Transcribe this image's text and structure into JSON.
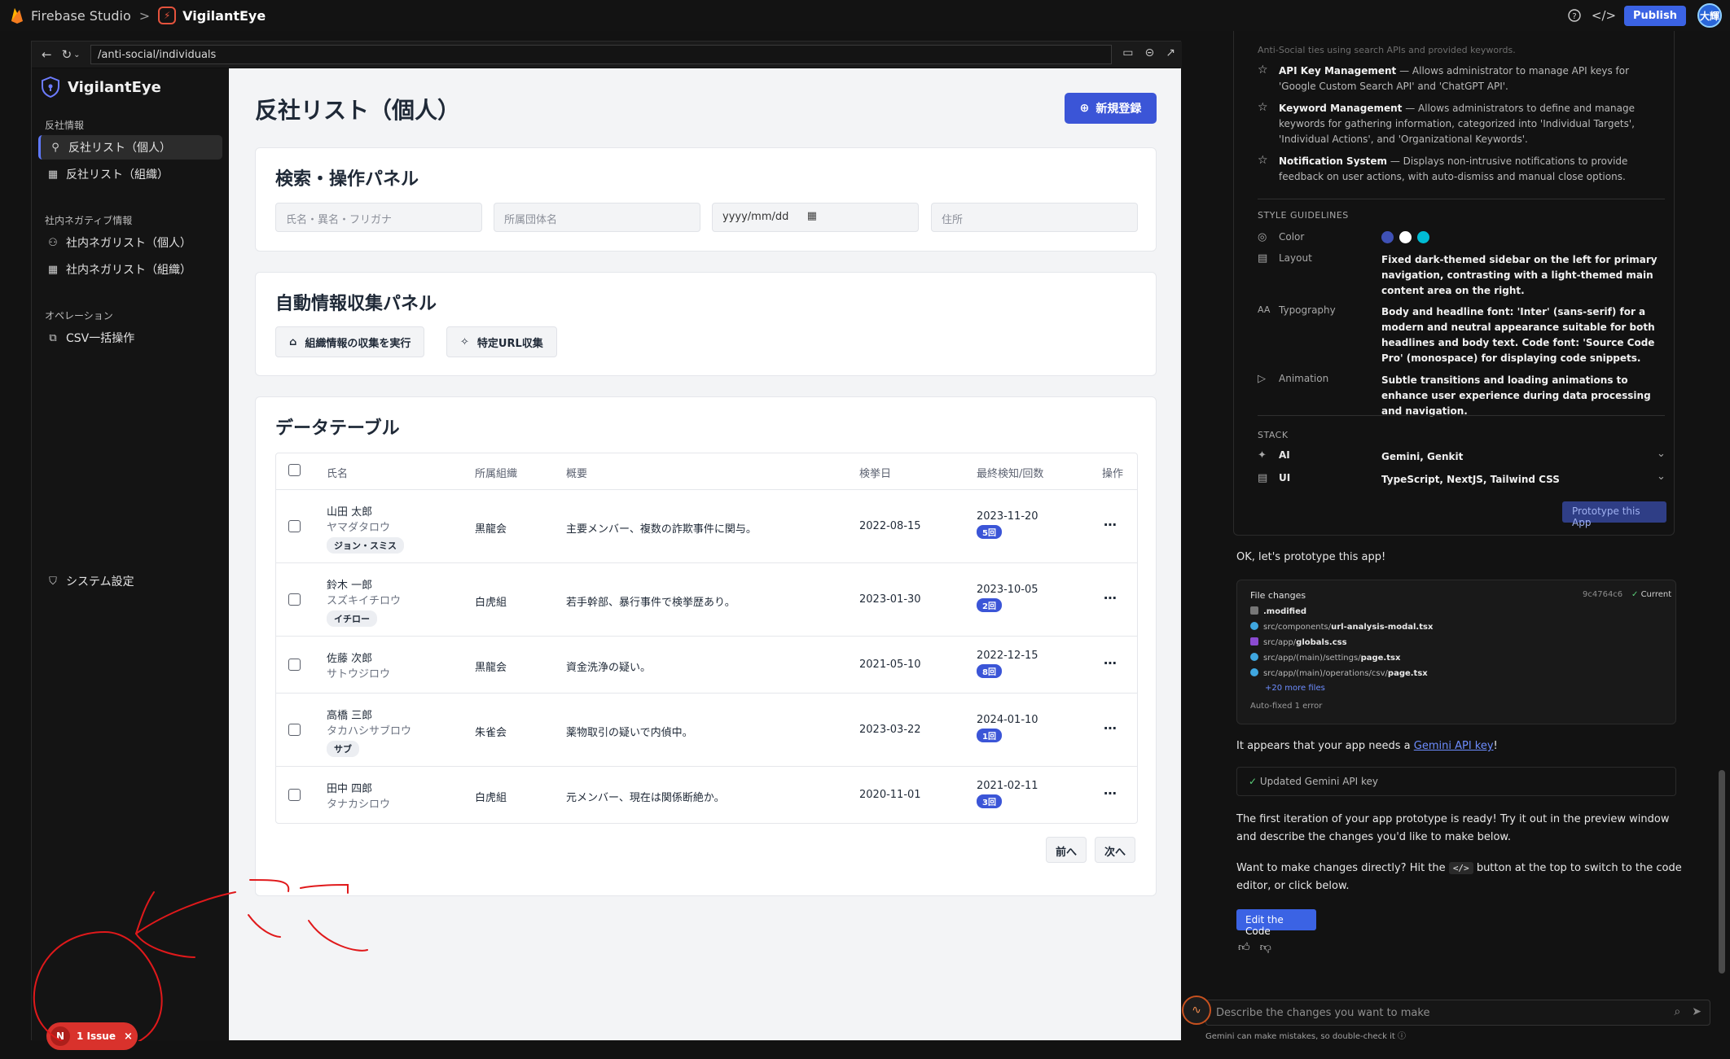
{
  "topbar": {
    "studio_name": "Firebase Studio",
    "separator": ">",
    "project_name": "VigilantEye",
    "publish_label": "Publish",
    "avatar_text": "大輝"
  },
  "preview": {
    "url": "/anti-social/individuals"
  },
  "app": {
    "title": "VigilantEye",
    "sidebar": {
      "section1": "反社情報",
      "items1": [
        "反社リスト（個人）",
        "反社リスト（組織）"
      ],
      "section2": "社内ネガティブ情報",
      "items2": [
        "社内ネガリスト（個人）",
        "社内ネガリスト（組織）"
      ],
      "section3": "オペレーション",
      "items3": [
        "CSV一括操作"
      ],
      "settings": "システム設定"
    },
    "page_title": "反社リスト（個人）",
    "new_button": "新規登録",
    "search_panel": {
      "title": "検索・操作パネル",
      "placeholders": [
        "氏名・異名・フリガナ",
        "所属団体名",
        "yyyy/mm/dd",
        "住所"
      ]
    },
    "auto_panel": {
      "title": "自動情報収集パネル",
      "buttons": [
        "組織情報の収集を実行",
        "特定URL収集"
      ]
    },
    "table": {
      "title": "データテーブル",
      "headers": [
        "氏名",
        "所属組織",
        "概要",
        "検挙日",
        "最終検知/回数",
        "操作"
      ],
      "rows": [
        {
          "name": "山田 太郎",
          "kana": "ヤマダタロウ",
          "alias": "ジョン・スミス",
          "org": "黒龍会",
          "summary": "主要メンバー、複数の詐欺事件に関与。",
          "arrest": "2022-08-15",
          "last": "2023-11-20",
          "count": "5回"
        },
        {
          "name": "鈴木 一郎",
          "kana": "スズキイチロウ",
          "alias": "イチロー",
          "org": "白虎組",
          "summary": "若手幹部、暴行事件で検挙歴あり。",
          "arrest": "2023-01-30",
          "last": "2023-10-05",
          "count": "2回"
        },
        {
          "name": "佐藤 次郎",
          "kana": "サトウジロウ",
          "alias": "",
          "org": "黒龍会",
          "summary": "資金洗浄の疑い。",
          "arrest": "2021-05-10",
          "last": "2022-12-15",
          "count": "8回"
        },
        {
          "name": "高橋 三郎",
          "kana": "タカハシサブロウ",
          "alias": "サブ",
          "org": "朱雀会",
          "summary": "薬物取引の疑いで内偵中。",
          "arrest": "2023-03-22",
          "last": "2024-01-10",
          "count": "1回"
        },
        {
          "name": "田中 四郎",
          "kana": "タナカシロウ",
          "alias": "",
          "org": "白虎組",
          "summary": "元メンバー、現在は関係断絶か。",
          "arrest": "2020-11-01",
          "last": "2021-02-11",
          "count": "3回"
        }
      ],
      "more_label": "⋯",
      "prev": "前へ",
      "next": "次へ"
    },
    "issue_badge": {
      "letter": "N",
      "label": "1 Issue",
      "close": "×"
    }
  },
  "chat": {
    "top_fragment": "Anti-Social ties using search APIs and provided keywords.",
    "features": [
      {
        "title": "API Key Management",
        "text": " — Allows administrator to manage API keys for 'Google Custom Search API' and 'ChatGPT API'."
      },
      {
        "title": "Keyword Management",
        "text": " — Allows administrators to define and manage keywords for gathering information, categorized into 'Individual Targets', 'Individual Actions', and 'Organizational Keywords'."
      },
      {
        "title": "Notification System",
        "text": " — Displays non-intrusive notifications to provide feedback on user actions, with auto-dismiss and manual close options."
      }
    ],
    "style_caption": "STYLE GUIDELINES",
    "style": {
      "color_label": "Color",
      "colors": [
        "#3f51b5",
        "#ffffff",
        "#00bcd4"
      ],
      "layout_label": "Layout",
      "layout_value": "Fixed dark-themed sidebar on the left for primary navigation, contrasting with a light-themed main content area on the right.",
      "typography_label": "Typography",
      "typography_value": "Body and headline font: 'Inter' (sans-serif) for a modern and neutral appearance suitable for both headlines and body text. Code font: 'Source Code Pro' (monospace) for displaying code snippets.",
      "animation_label": "Animation",
      "animation_value": "Subtle transitions and loading animations to enhance user experience during data processing and navigation."
    },
    "stack_caption": "STACK",
    "stack": [
      {
        "label": "AI",
        "value": "Gemini, Genkit"
      },
      {
        "label": "UI",
        "value": "TypeScript, NextJS, Tailwind CSS"
      }
    ],
    "prototype_button": "Prototype this App",
    "msg1": "OK, let's prototype this app!",
    "file_changes": {
      "title": "File changes",
      "hash": "9c4764c6",
      "status": "Current",
      "files": [
        {
          "dir": "",
          "name": ".modified"
        },
        {
          "dir": "src/components/",
          "name": "url-analysis-modal.tsx"
        },
        {
          "dir": "src/app/",
          "name": "globals.css"
        },
        {
          "dir": "src/app/(main)/settings/",
          "name": "page.tsx"
        },
        {
          "dir": "src/app/(main)/operations/csv/",
          "name": "page.tsx"
        }
      ],
      "more": "+20 more files",
      "auto_fixed": "Auto-fixed 1 error"
    },
    "msg2_prefix": "It appears that your app needs a ",
    "msg2_link": "Gemini API key",
    "msg2_suffix": "!",
    "updated_label": "Updated Gemini API key",
    "msg3": "The first iteration of your app prototype is ready! Try it out in the preview window and describe the changes you'd like to make below.",
    "msg4_prefix": "Want to make changes directly? Hit the ",
    "msg4_code": "</>",
    "msg4_suffix": " button at the top to switch to the code editor, or click below.",
    "edit_button": "Edit the Code",
    "input_placeholder": "Describe the changes you want to make",
    "disclaimer": "Gemini can make mistakes, so double-check it"
  }
}
